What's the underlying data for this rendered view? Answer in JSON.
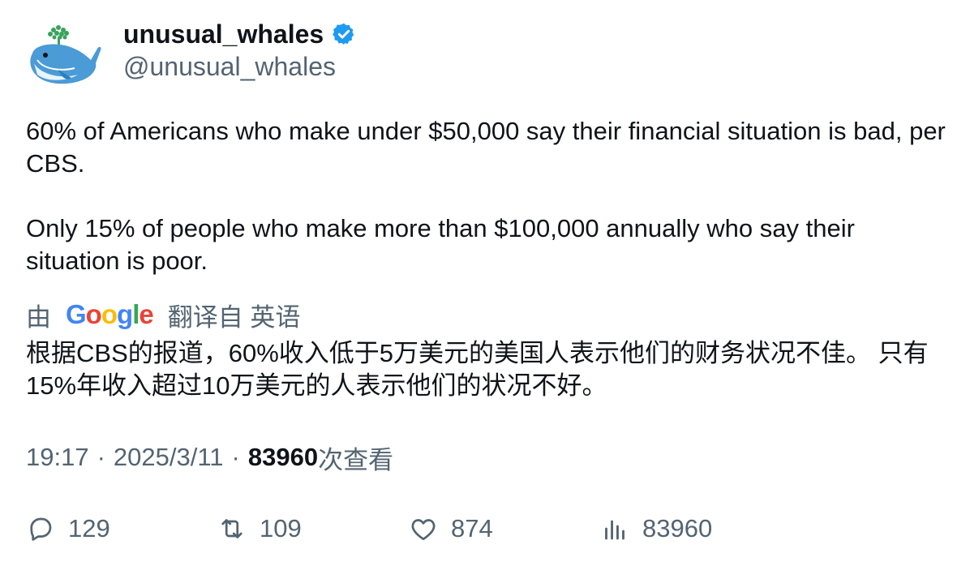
{
  "author": {
    "display_name": "unusual_whales",
    "handle": "@unusual_whales",
    "verified_color": "#1d9bf0"
  },
  "tweet": {
    "paragraphs": [
      "60% of Americans who make under $50,000 say their financial situation is bad, per CBS.",
      "Only 15% of people who make more than $100,000 annually who say their situation is poor."
    ]
  },
  "translation": {
    "prefix": "由",
    "provider": "Google",
    "suffix": "翻译自 英语",
    "text": "根据CBS的报道，60%收入低于5万美元的美国人表示他们的财务状况不佳。 只有15%年收入超过10万美元的人表示他们的状况不好。"
  },
  "meta": {
    "time": "19:17",
    "separator": "·",
    "date": "2025/3/11",
    "views_count": "83960",
    "views_label": "次查看"
  },
  "actions": {
    "replies": "129",
    "retweets": "109",
    "likes": "874",
    "views": "83960"
  },
  "icons": {
    "avatar": "whale-avatar-icon",
    "verified": "verified-badge-icon",
    "reply": "reply-icon",
    "retweet": "retweet-icon",
    "like": "heart-icon",
    "views": "analytics-icon"
  }
}
